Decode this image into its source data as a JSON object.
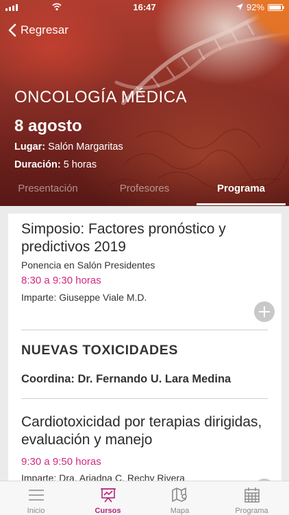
{
  "status_bar": {
    "time": "16:47",
    "battery": "92%"
  },
  "header": {
    "back_label": "Regresar",
    "course_title": "ONCOLOGÍA MÉDICA",
    "date": "8 agosto",
    "location_label": "Lugar:",
    "location_value": "Salón Margaritas",
    "duration_label": "Duración:",
    "duration_value": "5 horas"
  },
  "tabs": [
    {
      "label": "Presentación",
      "active": false
    },
    {
      "label": "Profesores",
      "active": false
    },
    {
      "label": "Programa",
      "active": true
    }
  ],
  "program": {
    "entry1": {
      "title": "Simposio: Factores pronóstico y predictivos 2019",
      "subtitle": "Ponencia en Salón Presidentes",
      "time": "8:30 a 9:30 horas",
      "speaker": "Imparte: Giuseppe Viale M.D."
    },
    "section": {
      "heading": "NUEVAS TOXICIDADES",
      "coordinator": "Coordina: Dr. Fernando U. Lara Medina"
    },
    "entry2": {
      "title": "Cardiotoxicidad por terapias dirigidas, evaluación y manejo",
      "time": "9:30 a 9:50 horas",
      "speaker": "Imparte: Dra. Ariadna C. Rechy Rivera"
    }
  },
  "bottom_nav": [
    {
      "label": "Inicio",
      "icon": "menu-icon",
      "active": false
    },
    {
      "label": "Cursos",
      "icon": "presentation-board-icon",
      "active": true
    },
    {
      "label": "Mapa",
      "icon": "map-icon",
      "active": false
    },
    {
      "label": "Programa",
      "icon": "calendar-icon",
      "active": false
    }
  ],
  "colors": {
    "accent": "#cf2a7f",
    "nav_active": "#b0237a",
    "header_red": "#a5392d",
    "orange": "#f47c2a"
  }
}
